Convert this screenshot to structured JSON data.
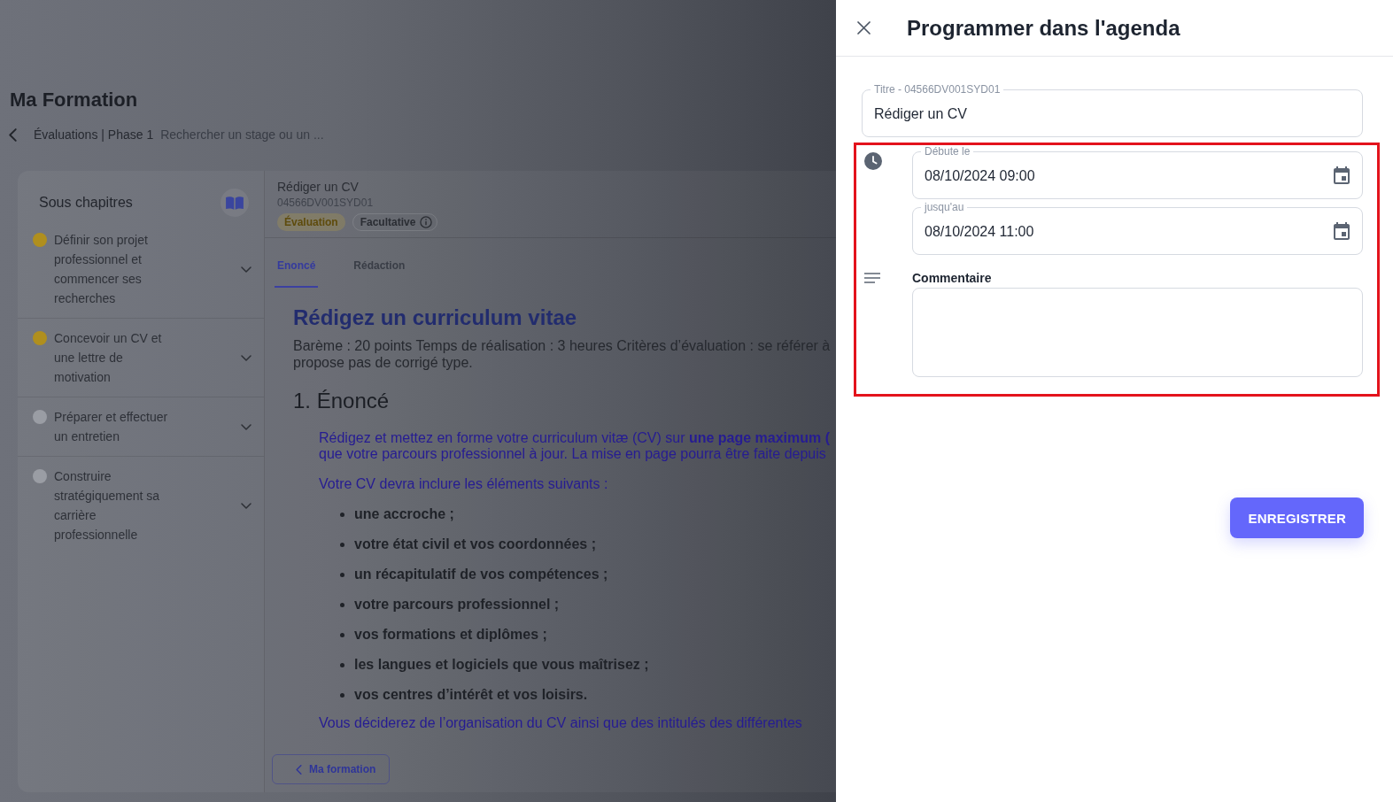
{
  "header": {
    "title": "Ma Formation",
    "breadcrumb": {
      "path": "Évaluations | Phase 1",
      "current": "Rechercher un stage ou un ..."
    }
  },
  "sidebar": {
    "title": "Sous chapitres",
    "items": [
      {
        "label": "Définir son projet professionnel et commencer ses recherches",
        "color": "#b08f1e",
        "expanded": false
      },
      {
        "label": "Concevoir un CV et une lettre de motivation",
        "color": "#b08f1e",
        "expanded": false
      },
      {
        "label": "Préparer et effectuer un entretien",
        "color": "#9a9da4",
        "expanded": false
      },
      {
        "label": "Construire stratégiquement sa carrière professionnelle",
        "color": "#9a9da4",
        "expanded": false
      }
    ]
  },
  "activity": {
    "title": "Rédiger un CV",
    "code": "04566DV001SYD01",
    "tags": [
      {
        "kind": "category",
        "label": "Évaluation"
      },
      {
        "kind": "optional",
        "label": "Facultative"
      }
    ],
    "tabs": [
      {
        "label": "Enoncé",
        "selected": true
      },
      {
        "label": "Rédaction",
        "selected": false
      }
    ],
    "content": {
      "heading": "Rédigez un curriculum vitae",
      "intro_lines": [
        "Barème : 20 points Temps de réalisation : 3 heures Critères d’évaluation : se référer à",
        "propose pas de corrigé type."
      ],
      "section_title": "1. Énoncé",
      "paragraph_lines": [
        "Rédigez et mettez en forme votre curriculum vitæ (CV) sur **une page maximum (**",
        "que votre parcours professionnel à jour. La mise en page pourra être faite depuis"
      ],
      "list_intro": "Votre CV devra inclure les éléments suivants :",
      "list": [
        "une accroche ;",
        "votre état civil et vos coordonnées ;",
        "un récapitulatif de vos compétences ;",
        "votre parcours professionnel ;",
        "vos formations et diplômes ;",
        "les langues et logiciels que vous maîtrisez ;",
        "vos centres d’intérêt et vos loisirs."
      ],
      "closing_line": "Vous déciderez de l’organisation du CV ainsi que des intitulés des différentes"
    },
    "back_button": "Ma formation"
  },
  "drawer": {
    "title": "Programmer dans l'agenda",
    "title_field": {
      "label": "Titre - 04566DV001SYD01",
      "value": "Rédiger un CV"
    },
    "schedule_highlighted": true,
    "start_field": {
      "label": "Débute le",
      "value": "08/10/2024 09:00"
    },
    "end_field": {
      "label": "jusqu'au",
      "value": "08/10/2024 11:00"
    },
    "comment": {
      "label": "Commentaire"
    },
    "save_button": "ENREGISTRER"
  }
}
